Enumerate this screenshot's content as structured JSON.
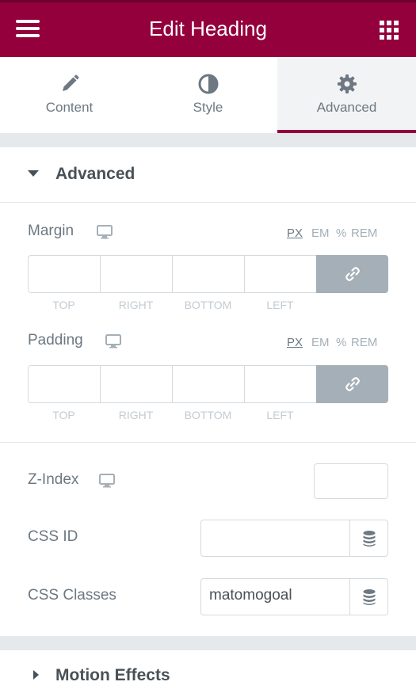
{
  "header": {
    "title": "Edit Heading",
    "menu_icon": "hamburger-icon",
    "grid_icon": "apps-grid-icon",
    "bg_color": "#93003c"
  },
  "tabs": [
    {
      "label": "Content",
      "icon": "pencil-icon"
    },
    {
      "label": "Style",
      "icon": "half-circle-icon"
    },
    {
      "label": "Advanced",
      "icon": "gear-icon",
      "active": true
    }
  ],
  "advanced_section": {
    "title": "Advanced",
    "margin": {
      "label": "Margin",
      "units": [
        "PX",
        "EM",
        "%",
        "REM"
      ],
      "selected_unit": "PX",
      "sides": [
        "TOP",
        "RIGHT",
        "BOTTOM",
        "LEFT"
      ],
      "values": [
        "",
        "",
        "",
        ""
      ]
    },
    "padding": {
      "label": "Padding",
      "units": [
        "PX",
        "EM",
        "%",
        "REM"
      ],
      "selected_unit": "PX",
      "sides": [
        "TOP",
        "RIGHT",
        "BOTTOM",
        "LEFT"
      ],
      "values": [
        "",
        "",
        "",
        ""
      ]
    },
    "z_index": {
      "label": "Z-Index",
      "value": ""
    },
    "css_id": {
      "label": "CSS ID",
      "value": ""
    },
    "css_classes": {
      "label": "CSS Classes",
      "value": "matomogoal"
    }
  },
  "motion_section": {
    "title": "Motion Effects"
  }
}
